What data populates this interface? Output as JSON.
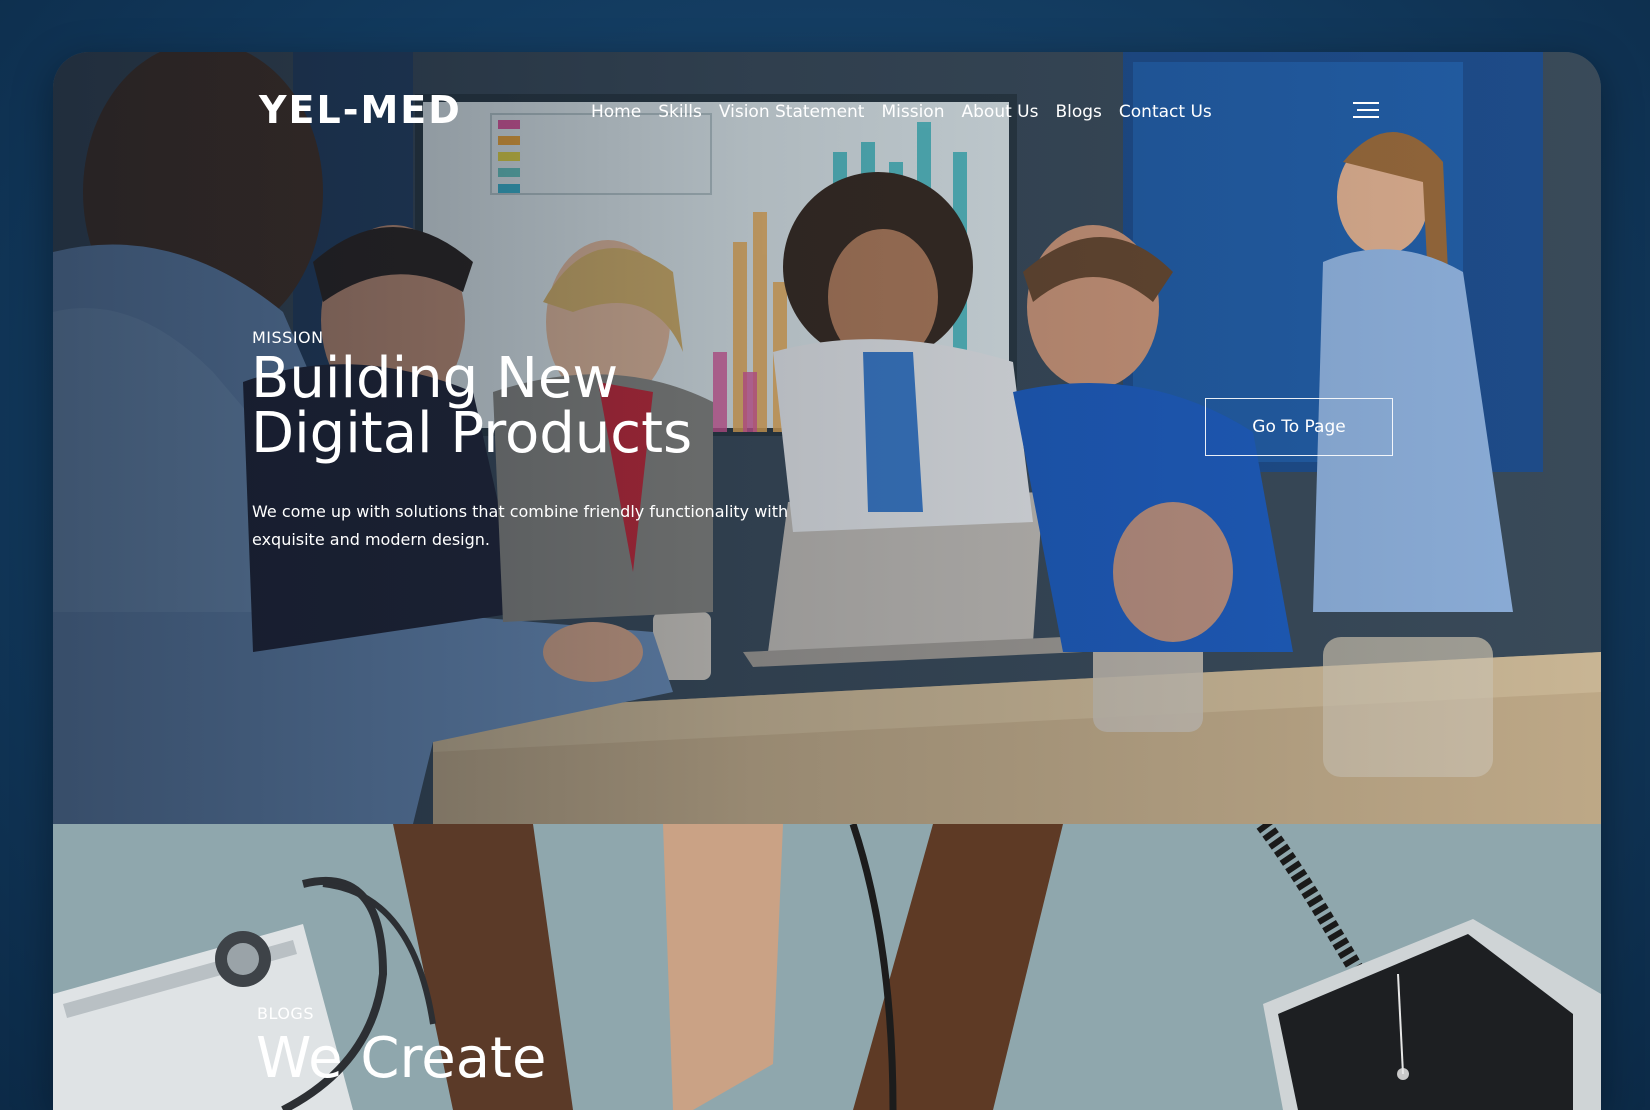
{
  "brand": {
    "logo_text": "YEL-MED"
  },
  "nav": {
    "items": [
      {
        "label": "Home"
      },
      {
        "label": "Skills"
      },
      {
        "label": "Vision Statement"
      },
      {
        "label": "Mission"
      },
      {
        "label": "About Us"
      },
      {
        "label": "Blogs"
      },
      {
        "label": "Contact Us"
      }
    ],
    "menu_icon": "hamburger-menu-icon"
  },
  "hero": {
    "eyebrow": "MISSION",
    "title_line1": "Building New",
    "title_line2": "Digital Products",
    "description": "We come up with solutions that combine friendly functionality with exquisite and modern design.",
    "cta_label": "Go To Page",
    "image": "medical-team-meeting-photo"
  },
  "blogs": {
    "eyebrow": "BLOGS",
    "title": "We Create",
    "image": "stethoscope-blood-pressure-photo"
  },
  "colors": {
    "page_background": "#123a5e",
    "text": "#ffffff"
  }
}
